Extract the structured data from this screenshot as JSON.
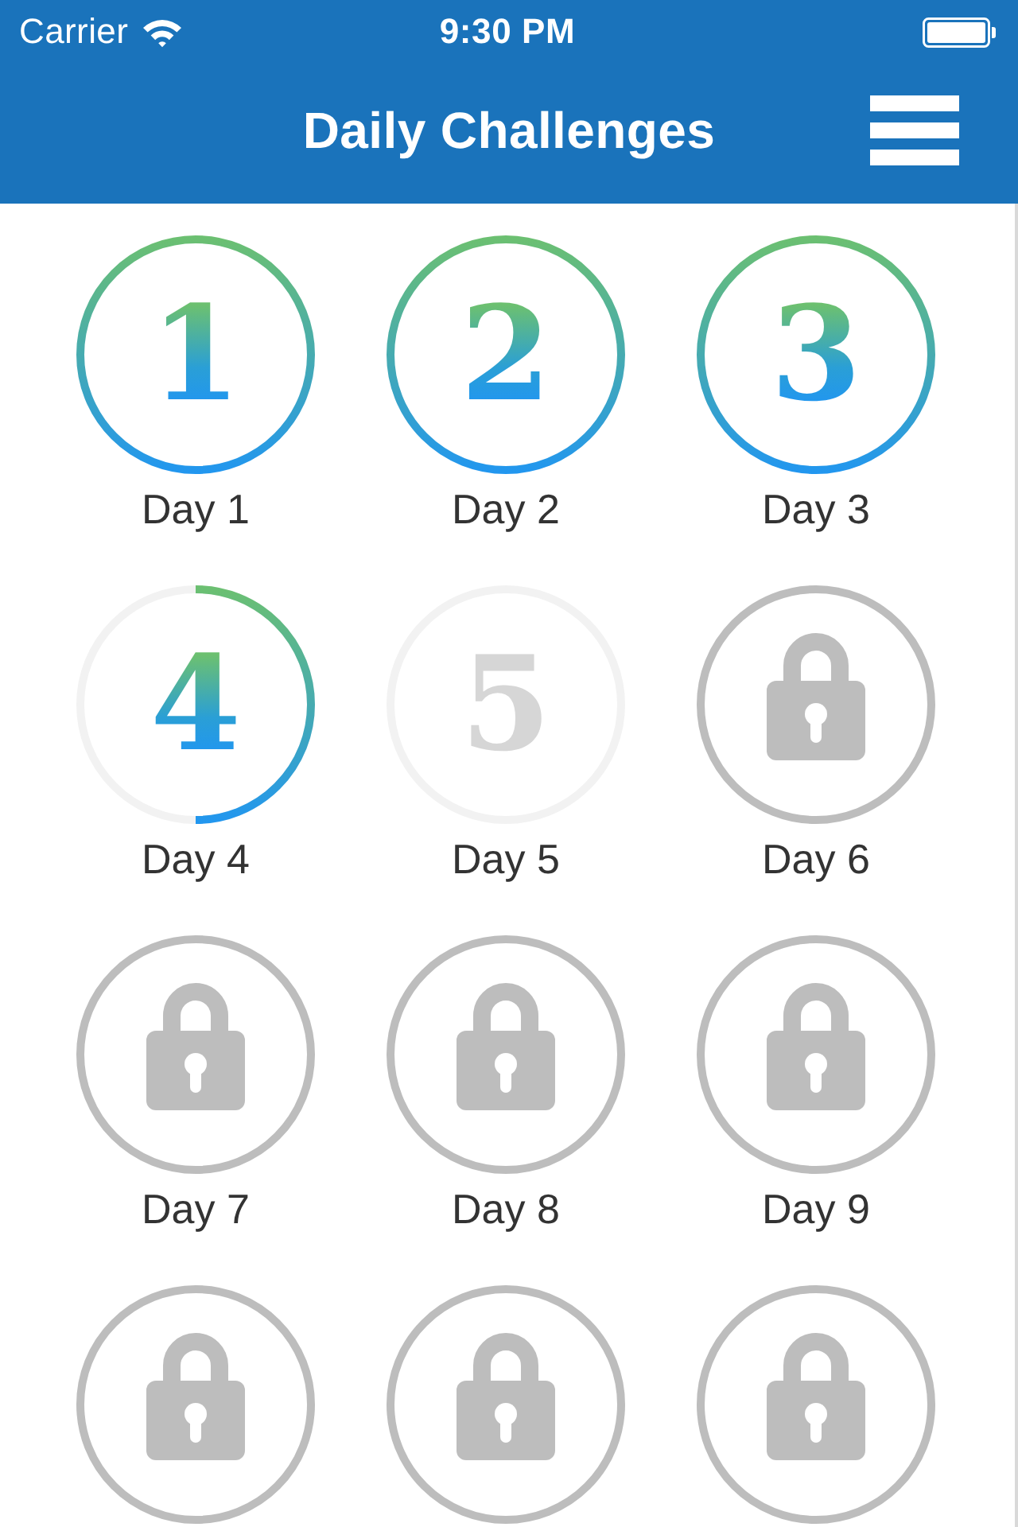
{
  "status_bar": {
    "carrier": "Carrier",
    "time": "9:30 PM"
  },
  "nav_bar": {
    "title": "Daily Challenges"
  },
  "days": [
    {
      "kind": "completed",
      "number": "1",
      "label": "Day 1"
    },
    {
      "kind": "completed",
      "number": "2",
      "label": "Day 2"
    },
    {
      "kind": "completed",
      "number": "3",
      "label": "Day 3"
    },
    {
      "kind": "in_progress",
      "number": "4",
      "label": "Day 4",
      "level": 0.5
    },
    {
      "kind": "available",
      "number": "5",
      "label": "Day 5"
    },
    {
      "kind": "locked",
      "label": "Day 6"
    },
    {
      "kind": "locked",
      "label": "Day 7"
    },
    {
      "kind": "locked",
      "label": "Day 8"
    },
    {
      "kind": "locked",
      "label": "Day 9"
    },
    {
      "kind": "locked"
    },
    {
      "kind": "locked"
    },
    {
      "kind": "locked"
    }
  ]
}
